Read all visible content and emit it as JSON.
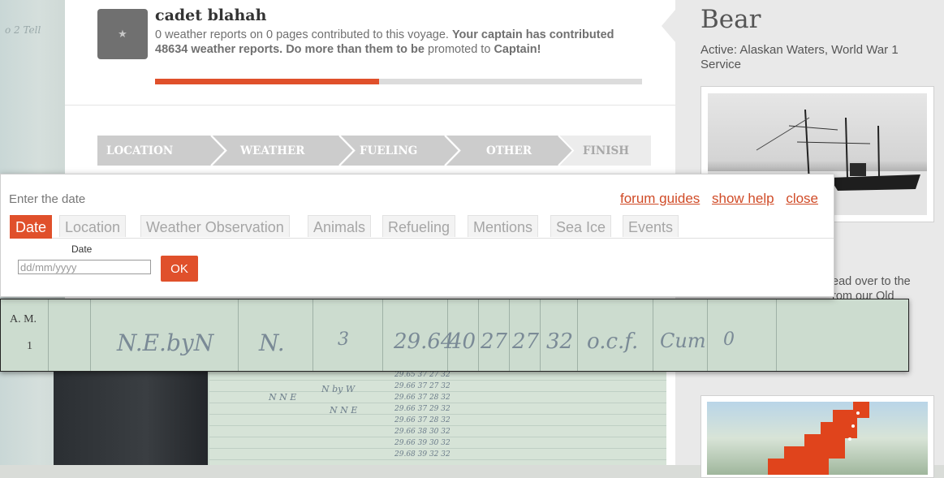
{
  "user": {
    "name": "cadet blahah",
    "stats_text": "0 weather reports on 0 pages contributed to this voyage.",
    "captain_text": "Your captain has contributed 48634 weather reports. Do more than them to be",
    "promote_text": "promoted to",
    "rank_text": "Captain!",
    "progress_percent": 46,
    "avatar_icon": "star-icon"
  },
  "steps": [
    "LOCATION",
    "WEATHER",
    "FUELING",
    "OTHER",
    "FINISH"
  ],
  "ship": {
    "name": "Bear",
    "active": "Active: Alaskan Waters, World War 1 Service",
    "partial_text_1": "ead over to the",
    "partial_text_2": "rom our Old"
  },
  "dialog": {
    "title": "Enter the date",
    "links": {
      "forum": "forum guides",
      "help": "show help",
      "close": "close"
    },
    "tabs": [
      "Date",
      "Location",
      "Weather Observation",
      "Animals",
      "Refueling",
      "Mentions",
      "Sea Ice",
      "Events"
    ],
    "active_tab": "Date",
    "date_label": "Date",
    "date_placeholder": "dd/mm/yyyy",
    "ok_label": "OK"
  },
  "zoom_strip": {
    "header": "A. M.",
    "row": "1",
    "entries": [
      "N.E.byN",
      "N.",
      "3",
      "29.64",
      "40",
      "27",
      "27",
      "32",
      "o.c.f.",
      "Cum",
      "0"
    ]
  },
  "background_scribble": "o 2 Tell",
  "colors": {
    "accent": "#e0502b",
    "step_bg": "#cccccc",
    "link": "#d04b27"
  }
}
